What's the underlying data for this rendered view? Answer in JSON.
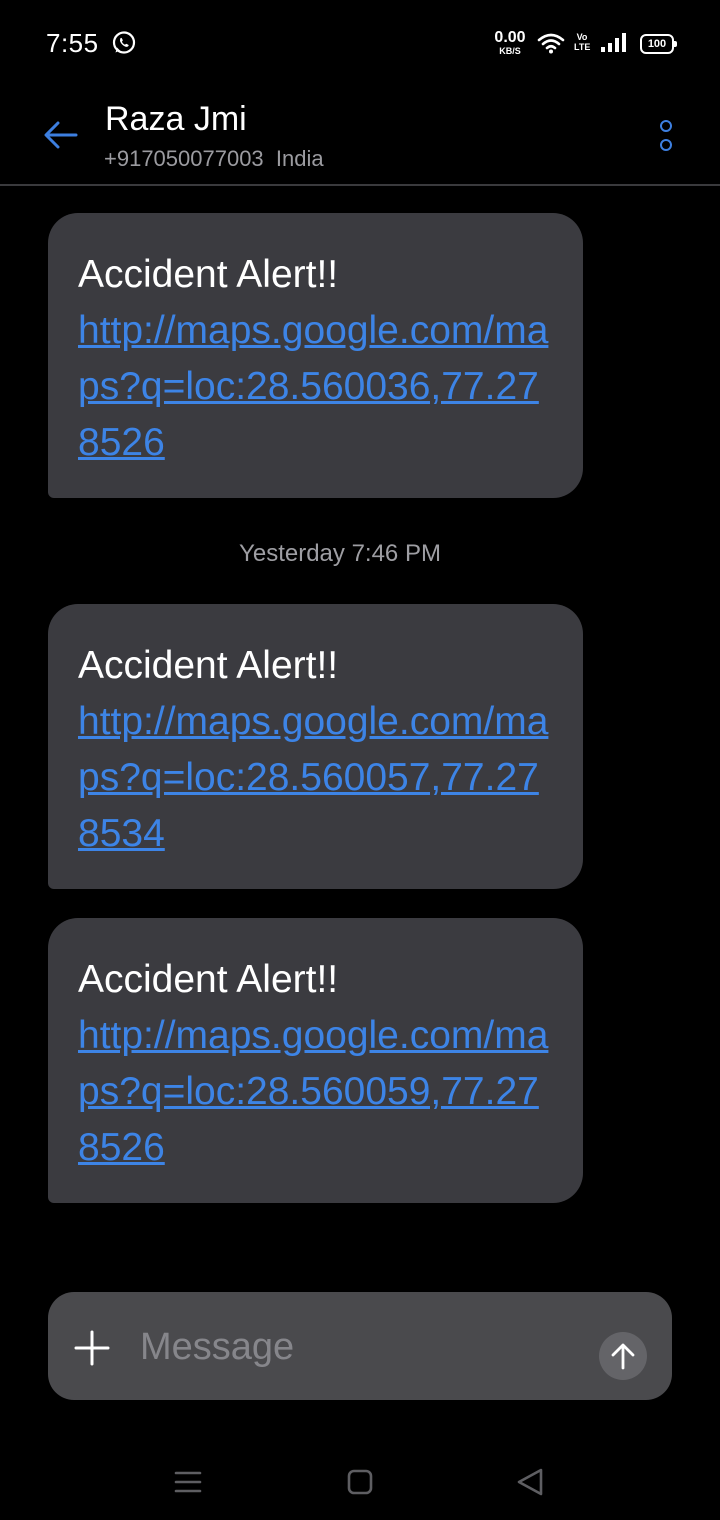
{
  "status_bar": {
    "time": "7:55",
    "net_speed_value": "0.00",
    "net_speed_unit": "KB/S",
    "volte_top": "Vo",
    "volte_bottom": "LTE",
    "battery": "100",
    "icons": [
      "whatsapp-icon",
      "wifi-icon",
      "signal-icon",
      "battery-icon"
    ]
  },
  "header": {
    "contact_name": "Raza Jmi",
    "phone": "+917050077003  India",
    "back_icon": "arrow-left-icon",
    "more_icon": "more-vertical-icon",
    "accent_color": "#3d7fe0"
  },
  "messages": [
    {
      "title": "Accident Alert!!",
      "link": "http://maps.google.com/maps?q=loc:28.560036,77.278526"
    },
    {
      "title": "Accident Alert!!",
      "link": "http://maps.google.com/maps?q=loc:28.560057,77.278534"
    },
    {
      "title": "Accident Alert!!",
      "link": "http://maps.google.com/maps?q=loc:28.560059,77.278526"
    }
  ],
  "timestamp": "Yesterday 7:46 PM",
  "composer": {
    "placeholder": "Message",
    "value": "",
    "add_icon": "plus-icon",
    "send_icon": "arrow-up-icon"
  },
  "navbar": {
    "icons": [
      "menu-icon",
      "home-square-icon",
      "back-triangle-icon"
    ]
  }
}
